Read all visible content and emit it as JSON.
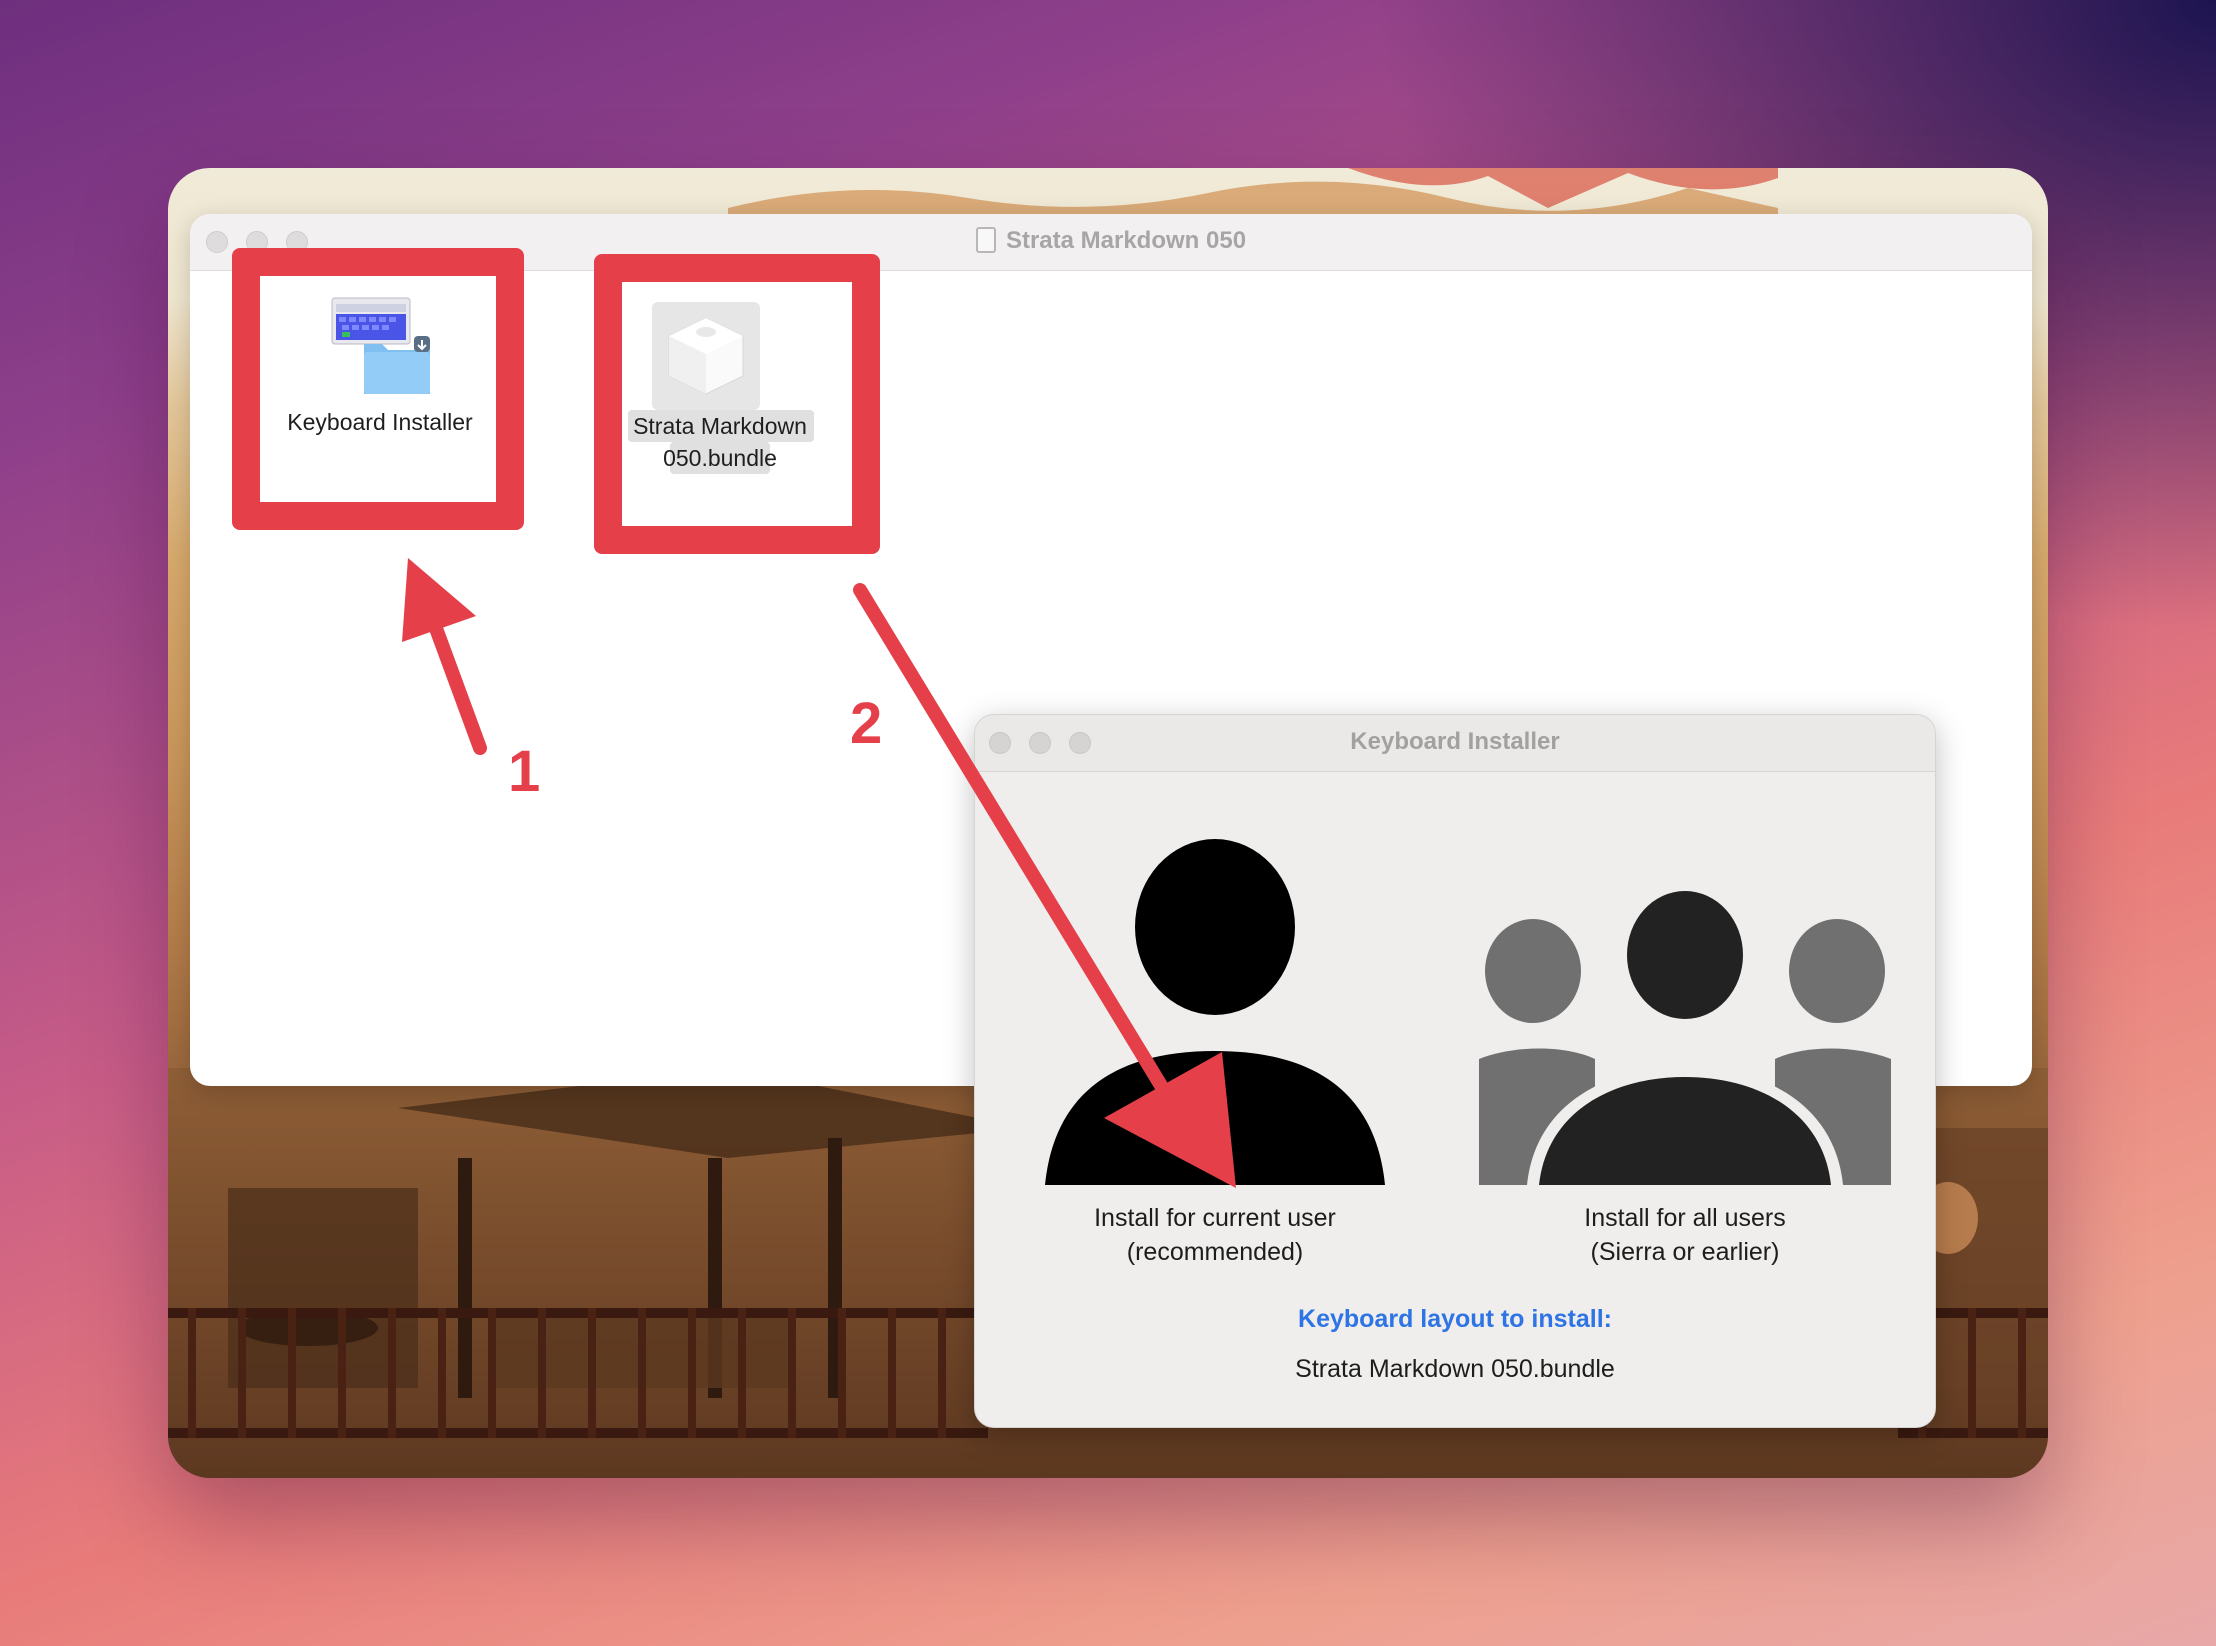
{
  "finder": {
    "title": "Strata Markdown 050",
    "items": [
      {
        "label": "Keyboard Installer"
      },
      {
        "label_line1": "Strata Markdown",
        "label_line2": "050.bundle"
      }
    ]
  },
  "installer": {
    "title": "Keyboard Installer",
    "option_current": {
      "line1": "Install for current user",
      "line2": "(recommended)"
    },
    "option_all": {
      "line1": "Install for all users",
      "line2": "(Sierra or earlier)"
    },
    "layout_heading": "Keyboard layout to install:",
    "layout_name": "Strata Markdown 050.bundle"
  },
  "annotations": {
    "step1": "1",
    "step2": "2"
  },
  "colors": {
    "annotation": "#e5404a",
    "link_blue": "#2e74e4"
  },
  "icons": [
    "disk-icon",
    "keyboard-installer-icon",
    "bundle-icon",
    "single-user-icon",
    "multiple-users-icon"
  ]
}
